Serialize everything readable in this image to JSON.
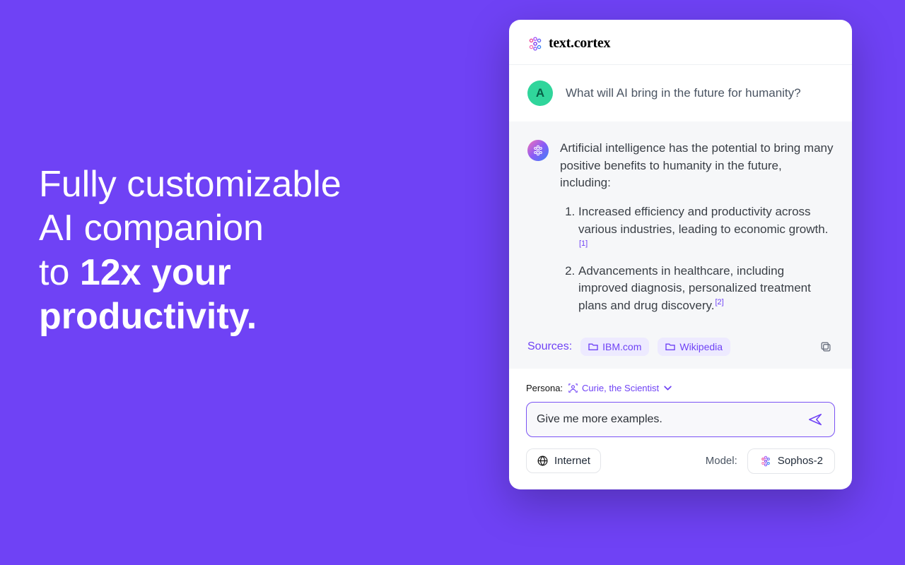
{
  "headline": {
    "line1": "Fully customizable",
    "line2": "AI companion",
    "line3_prefix": "to ",
    "line3_bold": "12x your",
    "line4_bold": "productivity."
  },
  "brand": {
    "name": "text.cortex"
  },
  "chat": {
    "user_initial": "A",
    "user_message": "What will AI bring in the future for humanity?",
    "ai_intro": "Artificial intelligence has the potential to bring many positive benefits to humanity in the future, including:",
    "ai_points": [
      {
        "text": "Increased efficiency and productivity across various industries, leading to economic growth.",
        "ref": "[1]"
      },
      {
        "text": "Advancements in healthcare, including improved diagnosis, personalized treatment plans and drug discovery.",
        "ref": "[2]"
      }
    ],
    "sources_label": "Sources:",
    "sources": [
      "IBM.com",
      "Wikipedia"
    ]
  },
  "footer": {
    "persona_label": "Persona:",
    "persona_value": "Curie, the Scientist",
    "input_value": "Give me more examples.",
    "internet_label": "Internet",
    "model_label": "Model:",
    "model_value": "Sophos-2"
  }
}
